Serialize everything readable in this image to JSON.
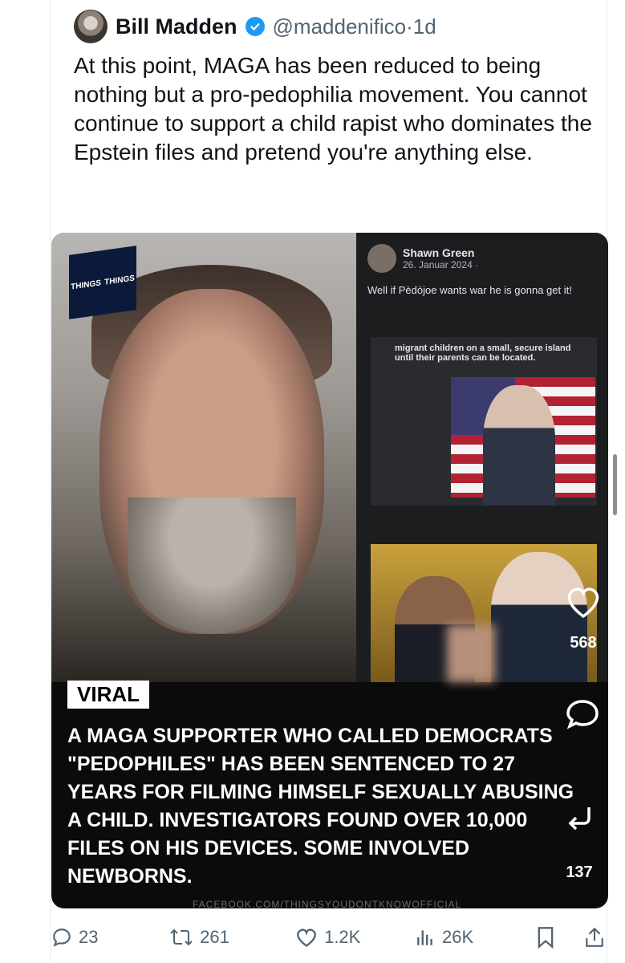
{
  "tweet": {
    "author_name": "Bill Madden",
    "handle": "@maddenifico",
    "separator": "·",
    "time": "1d",
    "text": "At this point, MAGA has been reduced to being nothing but a pro-pedophilia movement. You cannot continue to support a child rapist who dominates the Epstein files and pretend you're anything else."
  },
  "media": {
    "logo_left": "THINGS",
    "logo_right": "THINGS",
    "fb_post": {
      "name": "Shawn Green",
      "date": "26. Januar 2024 ·",
      "text": "Well if Pèdòjoe wants war he is gonna get it!",
      "inner_caption": "migrant children on a small, secure island until their parents can be located."
    },
    "viral_label": "VIRAL",
    "headline": "A MAGA SUPPORTER WHO CALLED DEMOCRATS \"PEDOPHILES\" HAS BEEN SENTENCED TO 27 YEARS FOR FILMING HIMSELF SEXUALLY ABUSING A CHILD. INVESTIGATORS FOUND OVER 10,000 FILES ON HIS DEVICES. SOME INVOLVED NEWBORNS.",
    "source": "FACEBOOK.COM/THINGSYOUDONTKNOWOFFICIAL",
    "overlay_likes": "568",
    "overlay_shares": "137"
  },
  "actions": {
    "replies": "23",
    "reposts": "261",
    "likes": "1.2K",
    "views": "26K"
  },
  "colors": {
    "verified": "#1d9bf0",
    "muted": "#536471"
  }
}
